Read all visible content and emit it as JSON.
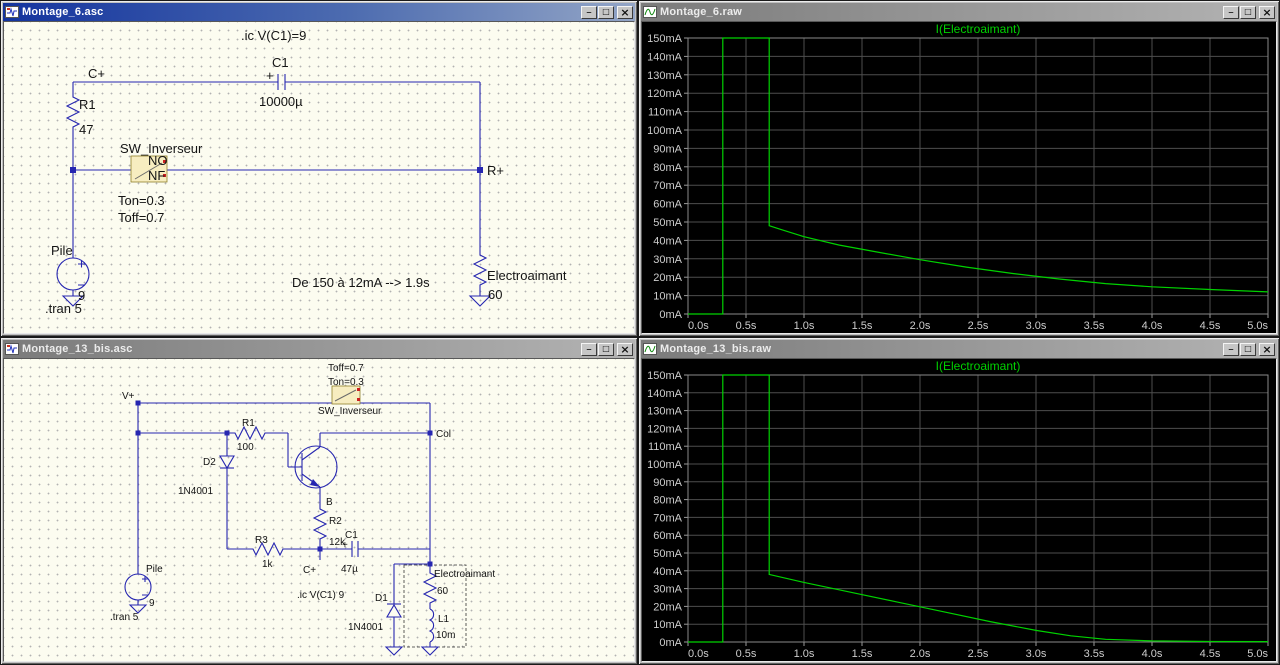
{
  "chrome": {
    "minimize": "_",
    "maximize": "□",
    "close": "×"
  },
  "windows": [
    {
      "title": "Montage_6.asc",
      "texts": {
        "ic_directive": ".ic V(C1)=9",
        "net_cplus": "C+",
        "cap_name": "C1",
        "cap_plus": "+",
        "cap_value": "10000µ",
        "r1_name": "R1",
        "r1_value": "47",
        "switch_name": "SW_Inverseur",
        "switch_no": "NO",
        "switch_nf": "NF",
        "ton": "Ton=0.3",
        "toff": "Toff=0.7",
        "battery_name": "Pile",
        "battery_value": "9",
        "tran_directive": ".tran 5",
        "net_rplus": "R+",
        "load_name": "Electroaimant",
        "load_value": "60",
        "note": "De 150 à 12mA --> 1.9s"
      }
    },
    {
      "title": "Montage_6.raw"
    },
    {
      "title": "Montage_13_bis.asc",
      "texts": {
        "toff": "Toff=0.7",
        "ton": "Ton=0.3",
        "switch_name": "SW_Inverseur",
        "net_vplus": "V+",
        "r1_name": "R1",
        "r1_value": "100",
        "net_col": "Col",
        "d2_name": "D2",
        "d2_value": "1N4001",
        "net_b": "B",
        "r2_name": "R2",
        "r2_value": "12k",
        "r3_name": "R3",
        "r3_value": "1k",
        "cap_name": "C1",
        "cap_plus": "+",
        "cap_value": "47µ",
        "net_cplus": "C+",
        "ic_directive": ".ic V(C1) 9",
        "battery_name": "Pile",
        "battery_value": "9",
        "tran_directive": ".tran 5",
        "load_name": "Electroaimant",
        "load_value": "60",
        "l1_name": "L1",
        "l1_value": "10m",
        "d1_name": "D1",
        "d1_value": "1N4001"
      }
    },
    {
      "title": "Montage_13_bis.raw"
    }
  ],
  "chart_data": [
    {
      "type": "line",
      "title": "I(Electroaimant)",
      "xlim": [
        0,
        5
      ],
      "ylim": [
        0,
        150
      ],
      "x_unit": "s",
      "y_unit": "mA",
      "grid": true,
      "line_color": "#00d200",
      "x_ticks": [
        "0.0s",
        "0.5s",
        "1.0s",
        "1.5s",
        "2.0s",
        "2.5s",
        "3.0s",
        "3.5s",
        "4.0s",
        "4.5s",
        "5.0s"
      ],
      "y_ticks": [
        "150mA",
        "140mA",
        "130mA",
        "120mA",
        "110mA",
        "100mA",
        "90mA",
        "80mA",
        "70mA",
        "60mA",
        "50mA",
        "40mA",
        "30mA",
        "20mA",
        "10mA",
        "0mA"
      ],
      "series": [
        {
          "name": "I(Electroaimant)",
          "x": [
            0,
            0.3,
            0.3,
            0.7,
            0.7,
            0.8,
            1.0,
            1.3,
            1.6,
            2.0,
            2.4,
            2.8,
            3.2,
            3.6,
            4.0,
            4.5,
            5.0
          ],
          "y": [
            0,
            0,
            150,
            150,
            48,
            46,
            42,
            37.5,
            34,
            29.5,
            25.5,
            22,
            19,
            16.5,
            14.8,
            13.3,
            12
          ]
        }
      ]
    },
    {
      "type": "line",
      "title": "I(Electroaimant)",
      "xlim": [
        0,
        5
      ],
      "ylim": [
        0,
        150
      ],
      "x_unit": "s",
      "y_unit": "mA",
      "grid": true,
      "line_color": "#00d200",
      "x_ticks": [
        "0.0s",
        "0.5s",
        "1.0s",
        "1.5s",
        "2.0s",
        "2.5s",
        "3.0s",
        "3.5s",
        "4.0s",
        "4.5s",
        "5.0s"
      ],
      "y_ticks": [
        "150mA",
        "140mA",
        "130mA",
        "120mA",
        "110mA",
        "100mA",
        "90mA",
        "80mA",
        "70mA",
        "60mA",
        "50mA",
        "40mA",
        "30mA",
        "20mA",
        "10mA",
        "0mA"
      ],
      "series": [
        {
          "name": "I(Electroaimant)",
          "x": [
            0,
            0.3,
            0.3,
            0.7,
            0.7,
            1.0,
            1.4,
            1.8,
            2.2,
            2.6,
            3.0,
            3.3,
            3.6,
            4.0,
            4.5,
            5.0
          ],
          "y": [
            0,
            0,
            150,
            150,
            38,
            33.5,
            28,
            22.5,
            17,
            11.5,
            6.5,
            3.5,
            1.5,
            0.6,
            0.3,
            0.2
          ]
        }
      ]
    }
  ]
}
